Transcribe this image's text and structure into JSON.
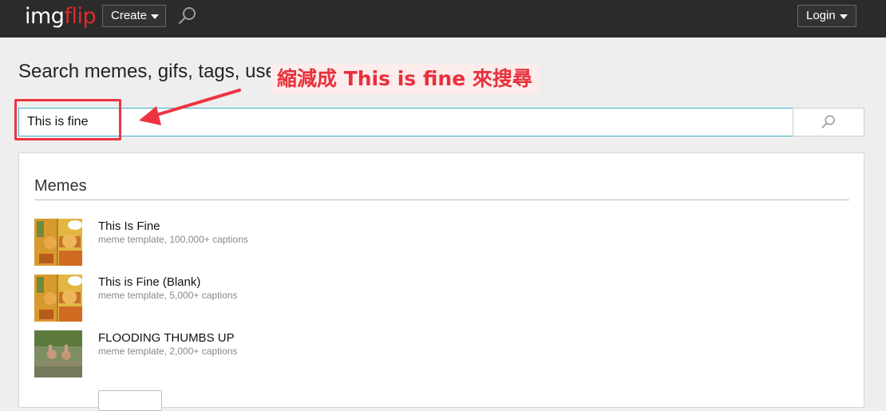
{
  "header": {
    "logo_part1": "img",
    "logo_part2": "flip",
    "create_label": "Create",
    "login_label": "Login"
  },
  "page": {
    "title": "Search memes, gifs, tags, use"
  },
  "search": {
    "value": "This is fine"
  },
  "results": {
    "section_title": "Memes",
    "items": [
      {
        "title": "This Is Fine",
        "subtitle": "meme template, 100,000+ captions"
      },
      {
        "title": "This is Fine (Blank)",
        "subtitle": "meme template, 5,000+ captions"
      },
      {
        "title": "FLOODING THUMBS UP",
        "subtitle": "meme template, 2,000+ captions"
      }
    ]
  },
  "annotation": {
    "callout_text": "縮減成 This is fine 來搜尋",
    "color": "#e8303c"
  },
  "colors": {
    "topbar": "#2b2b2b",
    "brand_red": "#e02a2a",
    "input_focus": "#3fb1c9"
  }
}
